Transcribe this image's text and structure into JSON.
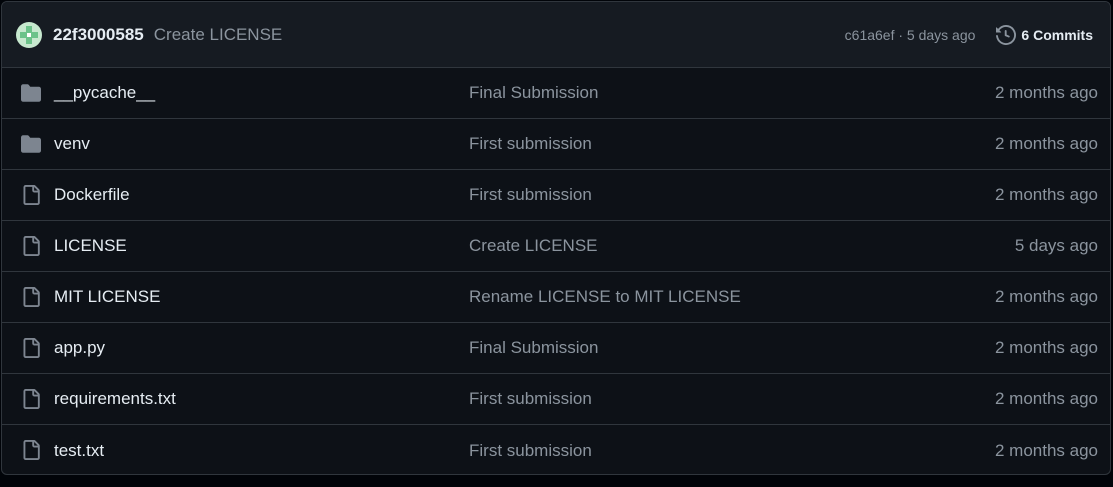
{
  "header": {
    "author": "22f3000585",
    "commit_message": "Create LICENSE",
    "commit_meta": "c61a6ef · 5 days ago",
    "commits_label": "6 Commits",
    "avatar_color": "#6cc38a",
    "history_icon": "history-icon"
  },
  "files": [
    {
      "type": "folder",
      "icon": "folder-icon",
      "name": "__pycache__",
      "message": "Final Submission",
      "age": "2 months ago"
    },
    {
      "type": "folder",
      "icon": "folder-icon",
      "name": "venv",
      "message": "First submission",
      "age": "2 months ago"
    },
    {
      "type": "file",
      "icon": "file-icon",
      "name": "Dockerfile",
      "message": "First submission",
      "age": "2 months ago"
    },
    {
      "type": "file",
      "icon": "file-icon",
      "name": "LICENSE",
      "message": "Create LICENSE",
      "age": "5 days ago"
    },
    {
      "type": "file",
      "icon": "file-icon",
      "name": "MIT LICENSE",
      "message": "Rename LICENSE to MIT LICENSE",
      "age": "2 months ago"
    },
    {
      "type": "file",
      "icon": "file-icon",
      "name": "app.py",
      "message": "Final Submission",
      "age": "2 months ago"
    },
    {
      "type": "file",
      "icon": "file-icon",
      "name": "requirements.txt",
      "message": "First submission",
      "age": "2 months ago"
    },
    {
      "type": "file",
      "icon": "file-icon",
      "name": "test.txt",
      "message": "First submission",
      "age": "2 months ago"
    }
  ],
  "colors": {
    "background": "#0d1117",
    "header_background": "#161b22",
    "border": "#30363d",
    "text": "#e6edf3",
    "muted_text": "#8b949e",
    "folder_icon": "#7d8590"
  }
}
